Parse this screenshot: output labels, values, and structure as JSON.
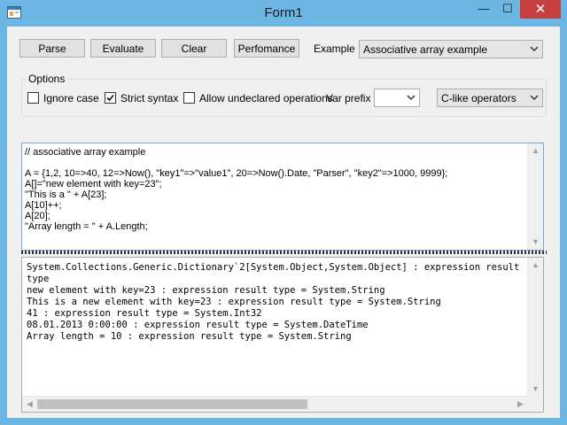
{
  "window": {
    "title": "Form1",
    "minimize_glyph": "—",
    "maximize_glyph": "☐",
    "close_glyph": "✕"
  },
  "toolbar": {
    "parse_label": "Parse",
    "evaluate_label": "Evaluate",
    "clear_label": "Clear",
    "performance_label": "Perfomance",
    "example_label": "Example",
    "example_selected": "Associative array example"
  },
  "options": {
    "group_label": "Options",
    "ignore_case": {
      "label": "Ignore case",
      "checked": false
    },
    "strict_syntax": {
      "label": "Strict syntax",
      "checked": true
    },
    "allow_undeclared": {
      "label": "Allow undeclared operations",
      "checked": false
    },
    "var_prefix_label": "Var prefix",
    "var_prefix_value": "",
    "operators_selected": "C-like operators"
  },
  "code_editor": {
    "lines": [
      "// associative array example",
      "",
      "A = {1,2, 10=>40, 12=>Now(), \"key1\"=>\"value1\", 20=>Now().Date, \"Parser\", \"key2\"=>1000, 9999};",
      "A[]=\"new element with key=23\";",
      "\"This is a \" + A[23];",
      "A[10]++;",
      "A[20];",
      "\"Array length = \" + A.Length;"
    ]
  },
  "output": {
    "lines": [
      "System.Collections.Generic.Dictionary`2[System.Object,System.Object] : expression result type",
      "new element with key=23 : expression result type = System.String",
      "This is a new element with key=23 : expression result type = System.String",
      "41 : expression result type = System.Int32",
      "08.01.2013 0:00:00 : expression result type = System.DateTime",
      "Array length = 10 : expression result type = System.String"
    ]
  },
  "icons": {
    "app": "app-icon",
    "dropdown": "chevron-down-icon",
    "check": "check-icon"
  },
  "colors": {
    "title_bar": "#6cb6e4",
    "close_button": "#c74040",
    "editor_border": "#7aa6d6",
    "form_background": "#f0f0f0"
  }
}
